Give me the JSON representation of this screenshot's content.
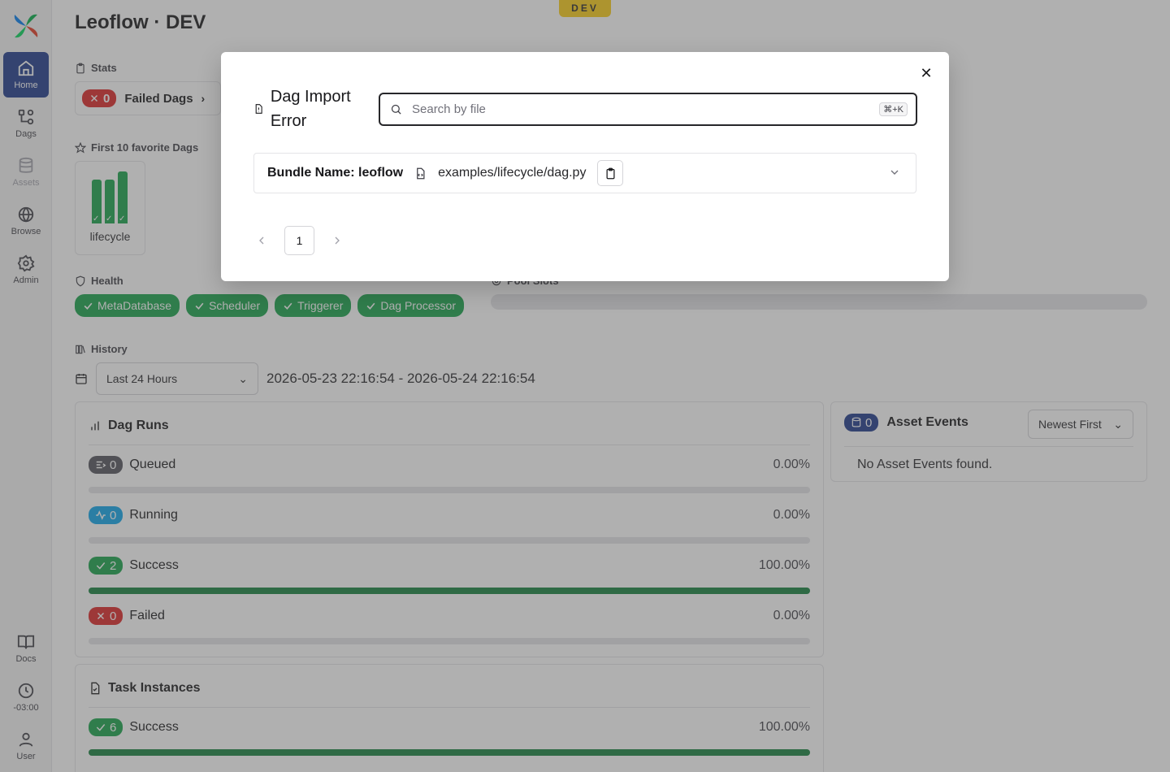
{
  "env_badge": "DEV",
  "page_title": "Leoflow · DEV",
  "sidebar": {
    "items": [
      {
        "label": "Home",
        "icon": "home-icon"
      },
      {
        "label": "Dags",
        "icon": "dags-icon"
      },
      {
        "label": "Assets",
        "icon": "database-icon"
      },
      {
        "label": "Browse",
        "icon": "globe-icon"
      },
      {
        "label": "Admin",
        "icon": "gear-icon"
      },
      {
        "label": "Docs",
        "icon": "book-icon"
      },
      {
        "label": "-03:00",
        "icon": "clock-icon"
      },
      {
        "label": "User",
        "icon": "user-icon"
      }
    ]
  },
  "stats": {
    "label": "Stats",
    "failed_count": "0",
    "failed_label": "Failed Dags"
  },
  "favorites": {
    "label": "First 10 favorite Dags",
    "dag_name": "lifecycle",
    "bars": [
      0.85,
      0.85,
      1.0
    ]
  },
  "health": {
    "label": "Health",
    "items": [
      "MetaDatabase",
      "Scheduler",
      "Triggerer",
      "Dag Processor"
    ]
  },
  "pool": {
    "label": "Pool Slots"
  },
  "history": {
    "label": "History",
    "range_select": "Last 24 Hours",
    "range_text": "2026-05-23 22:16:54 - 2026-05-24 22:16:54"
  },
  "dag_runs": {
    "title": "Dag Runs",
    "rows": [
      {
        "count": "0",
        "label": "Queued",
        "pct": "0.00%",
        "fraction": 0
      },
      {
        "count": "0",
        "label": "Running",
        "pct": "0.00%",
        "fraction": 0
      },
      {
        "count": "2",
        "label": "Success",
        "pct": "100.00%",
        "fraction": 1
      },
      {
        "count": "0",
        "label": "Failed",
        "pct": "0.00%",
        "fraction": 0
      }
    ]
  },
  "task_instances": {
    "title": "Task Instances",
    "rows": [
      {
        "count": "6",
        "label": "Success",
        "pct": "100.00%",
        "fraction": 1
      }
    ]
  },
  "asset_events": {
    "count": "0",
    "title": "Asset Events",
    "sort": "Newest First",
    "empty": "No Asset Events found."
  },
  "modal": {
    "title": "Dag Import Error",
    "search_placeholder": "Search by file",
    "shortcut": "⌘+K",
    "bundle_label": "Bundle Name: leoflow",
    "file_path": "examples/lifecycle/dag.py",
    "page": "1"
  },
  "colors": {
    "success": "#16a34a",
    "failed": "#dc2626",
    "active_nav": "#1e3a8a",
    "env_badge": "#facc15"
  }
}
